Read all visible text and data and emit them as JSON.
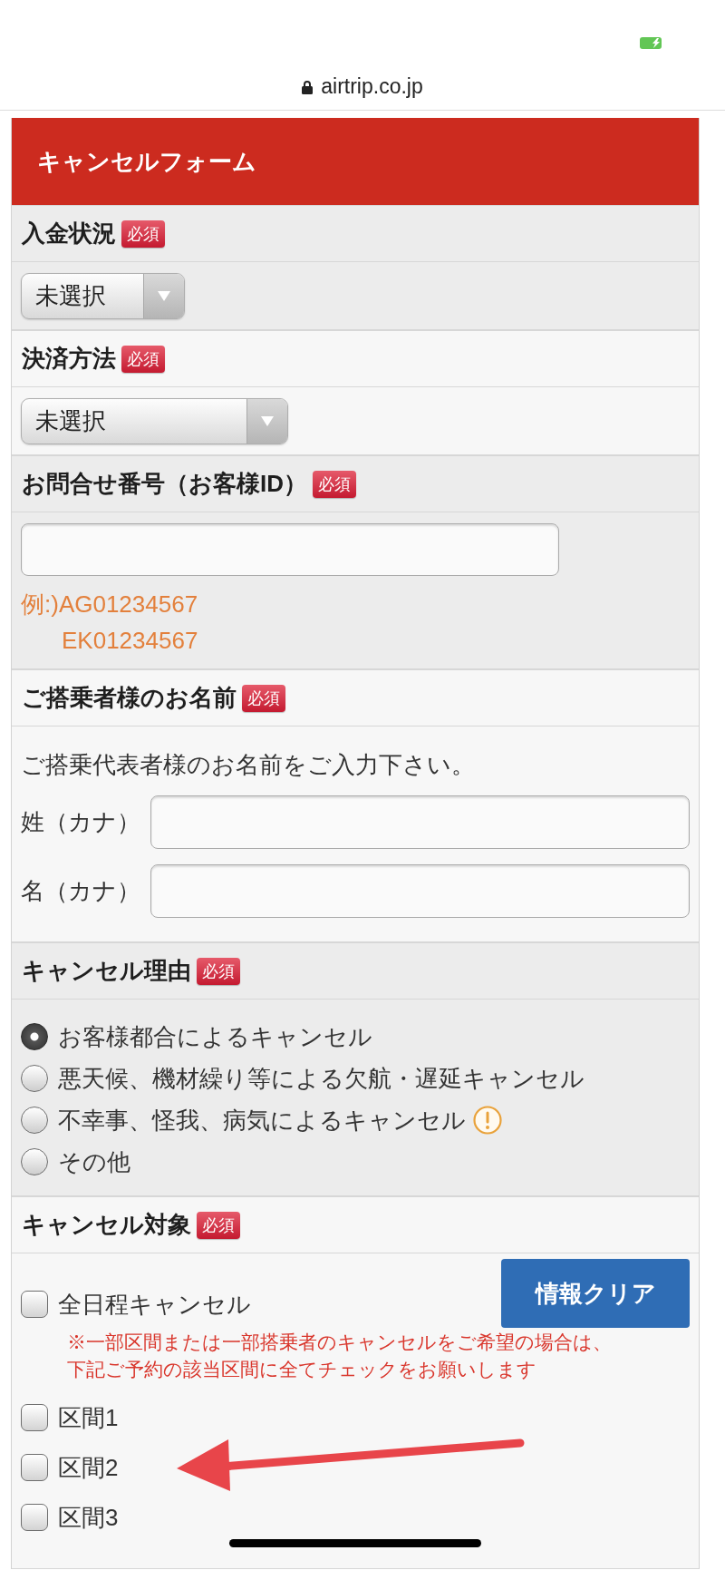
{
  "browser": {
    "url": "airtrip.co.jp"
  },
  "form": {
    "title": "キャンセルフォーム",
    "sections": [
      {
        "kind": "select",
        "label": "入金状況",
        "badge": "必須",
        "value": "未選択"
      },
      {
        "kind": "select",
        "label": "決済方法",
        "badge": "必須",
        "value": "未選択"
      },
      {
        "kind": "text_input",
        "label": "お問合せ番号（お客様ID）",
        "badge": "必須",
        "hint_lines": [
          "例:)AG01234567",
          "EK01234567"
        ]
      },
      {
        "kind": "name_inputs",
        "label": "ご搭乗者様のお名前",
        "badge": "必須",
        "instruction": "ご搭乗代表者様のお名前をご入力下さい。",
        "fields": [
          {
            "label": "姓（カナ）"
          },
          {
            "label": "名（カナ）"
          }
        ]
      },
      {
        "kind": "radio_group",
        "label": "キャンセル理由",
        "badge": "必須",
        "options": [
          {
            "label": "お客様都合によるキャンセル",
            "selected": true,
            "warning": false
          },
          {
            "label": "悪天候、機材繰り等による欠航・遅延キャンセル",
            "selected": false,
            "warning": false
          },
          {
            "label": "不幸事、怪我、病気によるキャンセル",
            "selected": false,
            "warning": true
          },
          {
            "label": "その他",
            "selected": false,
            "warning": false
          }
        ]
      },
      {
        "kind": "checkbox_group",
        "label": "キャンセル対象",
        "badge": "必須",
        "clear_button": "情報クリア",
        "all_option": {
          "label": "全日程キャンセル",
          "checked": false
        },
        "note_lines": [
          "※一部区間または一部搭乗者のキャンセルをご希望の場合は、",
          "下記ご予約の該当区間に全てチェックをお願いします"
        ],
        "segments": [
          {
            "label": "区間1",
            "checked": false
          },
          {
            "label": "区間2",
            "checked": false
          },
          {
            "label": "区間3",
            "checked": false
          }
        ]
      }
    ]
  }
}
